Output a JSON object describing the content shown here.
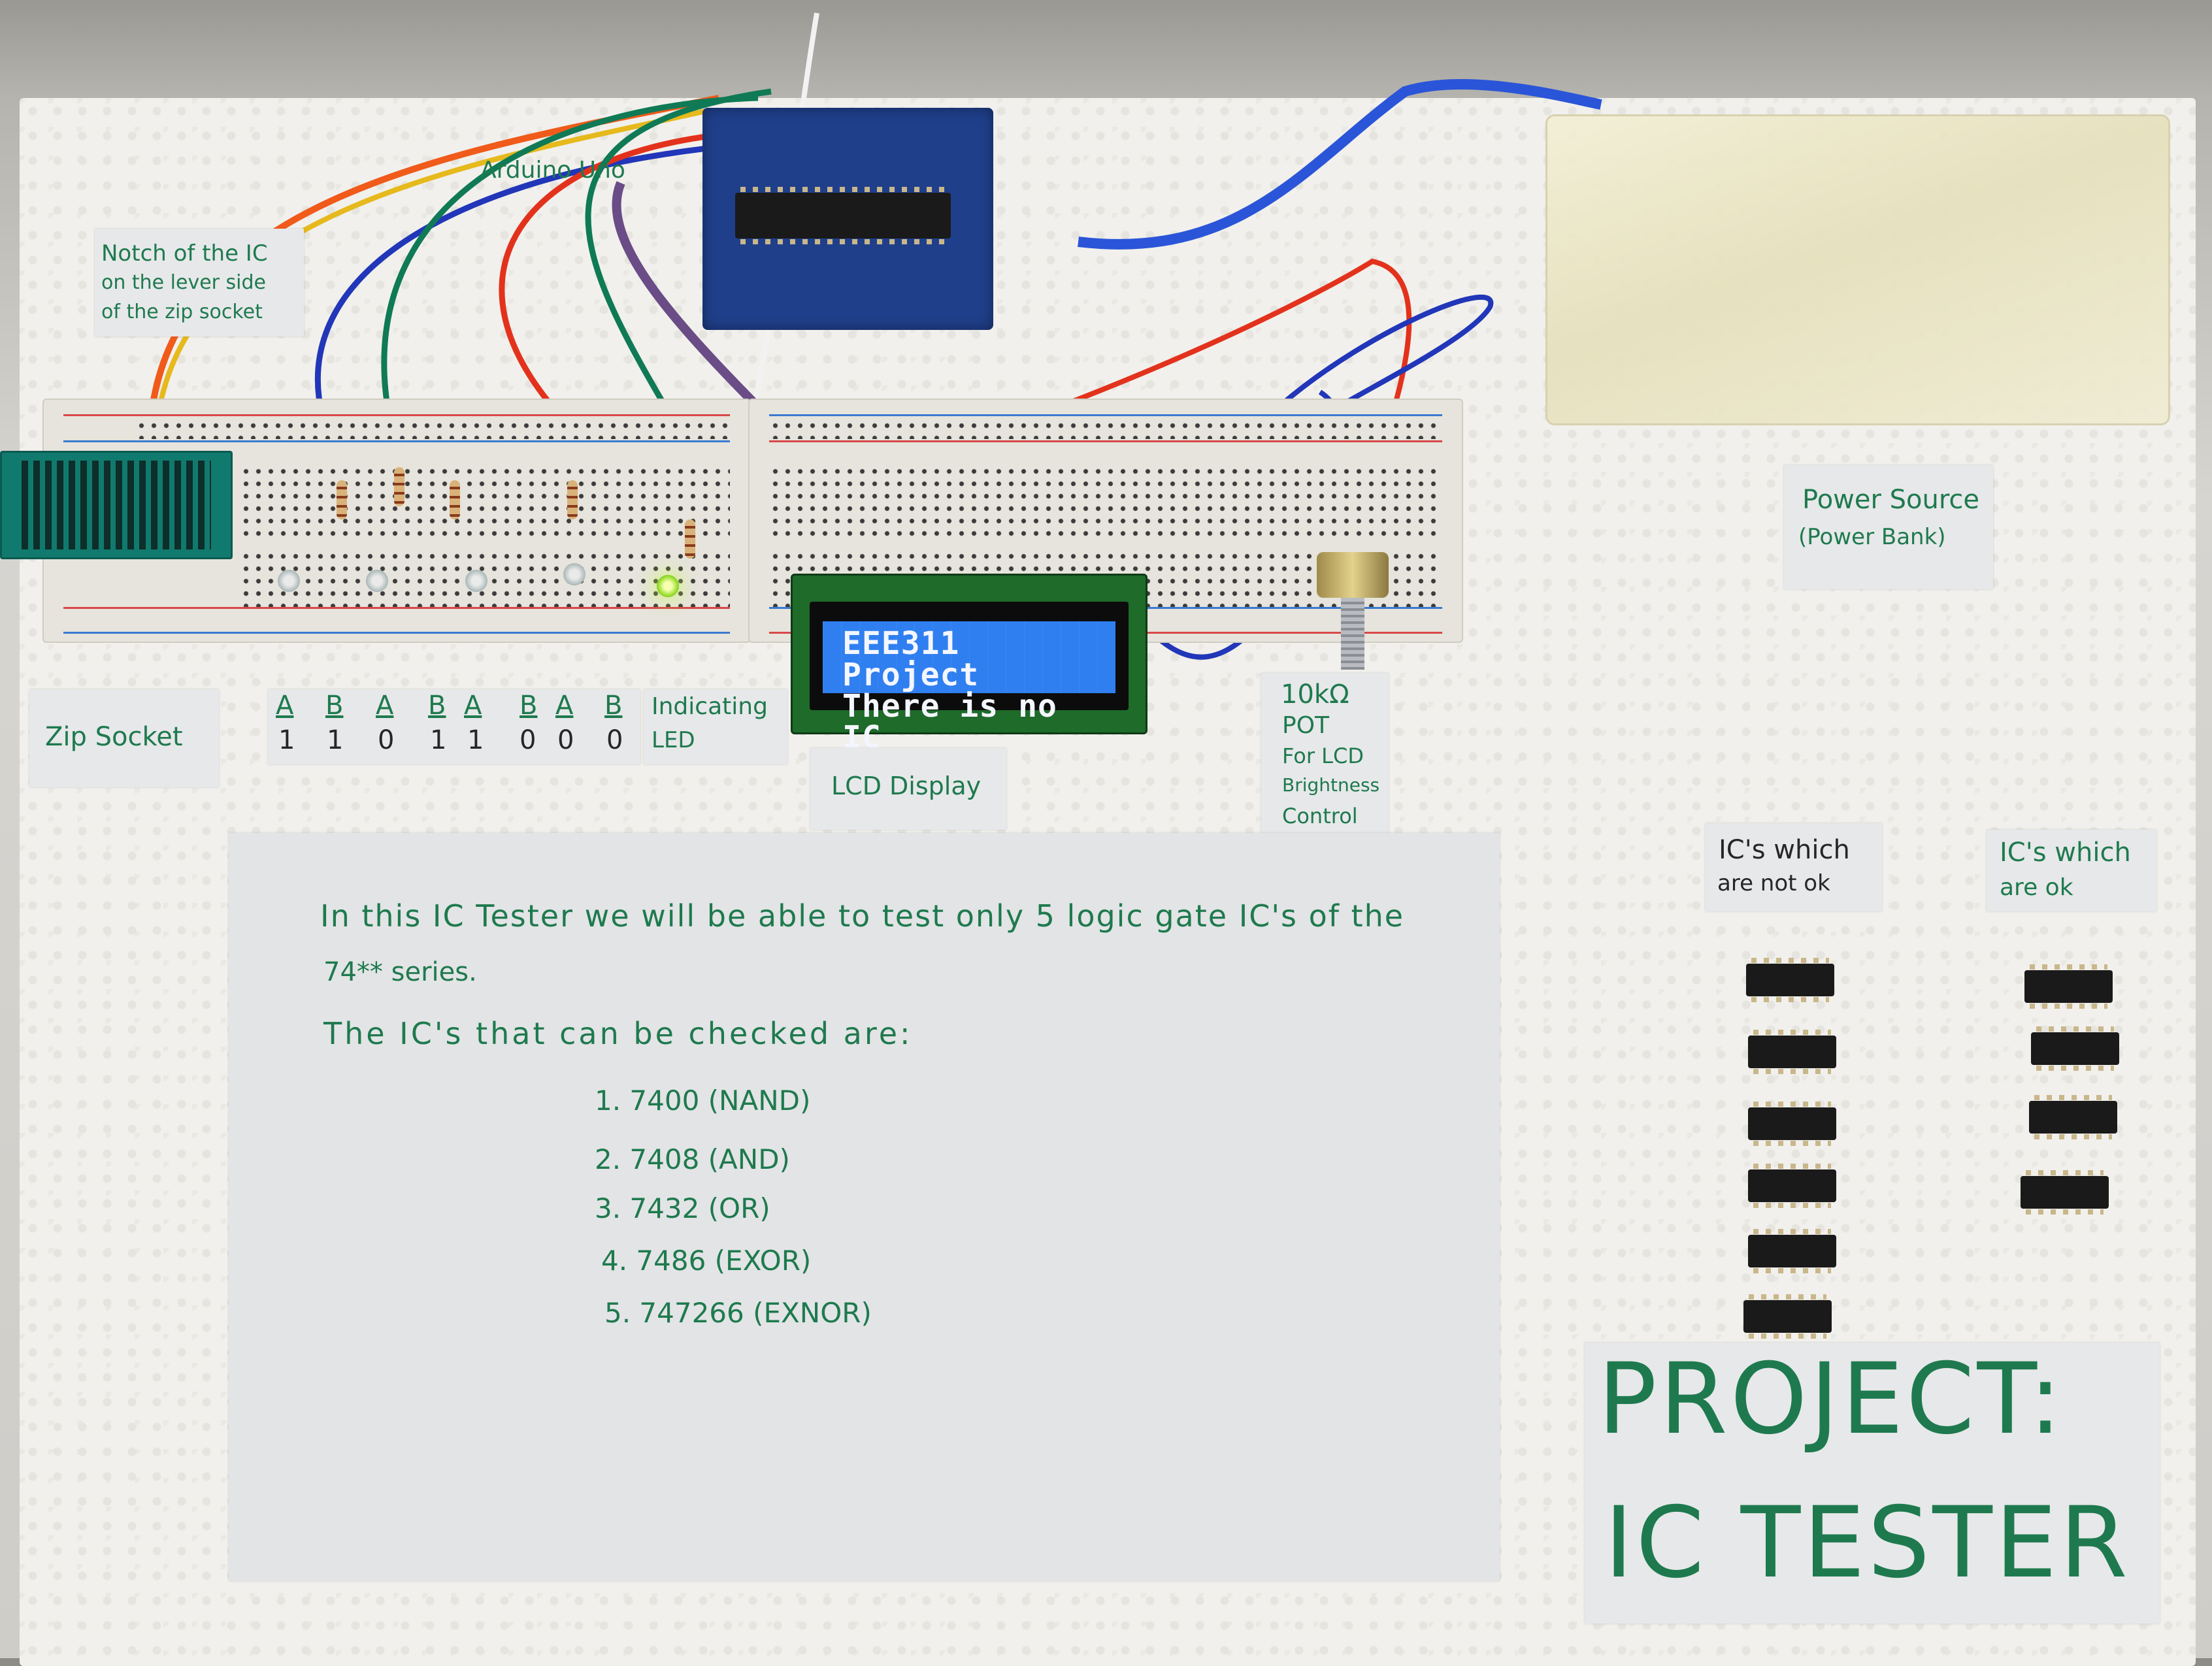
{
  "scene": {
    "description": "Photo of an Arduino-based IC tester project mounted on a styrofoam board",
    "accent_ink": "#1e7a4e",
    "lcd_color": "#2f7ff0"
  },
  "labels": {
    "notch_note": [
      "Notch of the IC",
      "on the lever side",
      "of the zip socket"
    ],
    "arduino": "Arduino Uno",
    "zip_socket": "Zip Socket",
    "indicating_led": [
      "Indicating",
      "LED"
    ],
    "lcd_display": "LCD Display",
    "pot": [
      "10kΩ",
      "POT",
      "For LCD",
      "Brightness",
      "Control"
    ],
    "power_source": [
      "Power Source",
      "(Power Bank)"
    ],
    "ics_not_ok": [
      "IC's which",
      "are not ok"
    ],
    "ics_ok": [
      "IC's which",
      "are ok"
    ]
  },
  "truth_inputs": [
    {
      "a_label": "A",
      "b_label": "B",
      "a": "1",
      "b": "1"
    },
    {
      "a_label": "A",
      "b_label": "B",
      "a": "0",
      "b": "1"
    },
    {
      "a_label": "A",
      "b_label": "B",
      "a": "1",
      "b": "0"
    },
    {
      "a_label": "A",
      "b_label": "B",
      "a": "0",
      "b": "0"
    }
  ],
  "lcd": {
    "line1": "EEE311 Project",
    "line2": "There is no IC"
  },
  "description_paper": {
    "intro_line1": "In this IC Tester we will be able to test only 5 logic gate IC's of the",
    "intro_line2": "74** series.",
    "list_heading": "The IC's that can be checked are:",
    "ic_list": [
      "1. 7400 (NAND)",
      "2. 7408 (AND)",
      "3. 7432 (OR)",
      "4. 7486 (EXOR)",
      "5. 747266 (EXNOR)"
    ]
  },
  "ic_bins": {
    "not_ok_count": 6,
    "ok_count": 4
  },
  "title_card": {
    "line1": "PROJECT:",
    "line2": "IC TESTER"
  }
}
